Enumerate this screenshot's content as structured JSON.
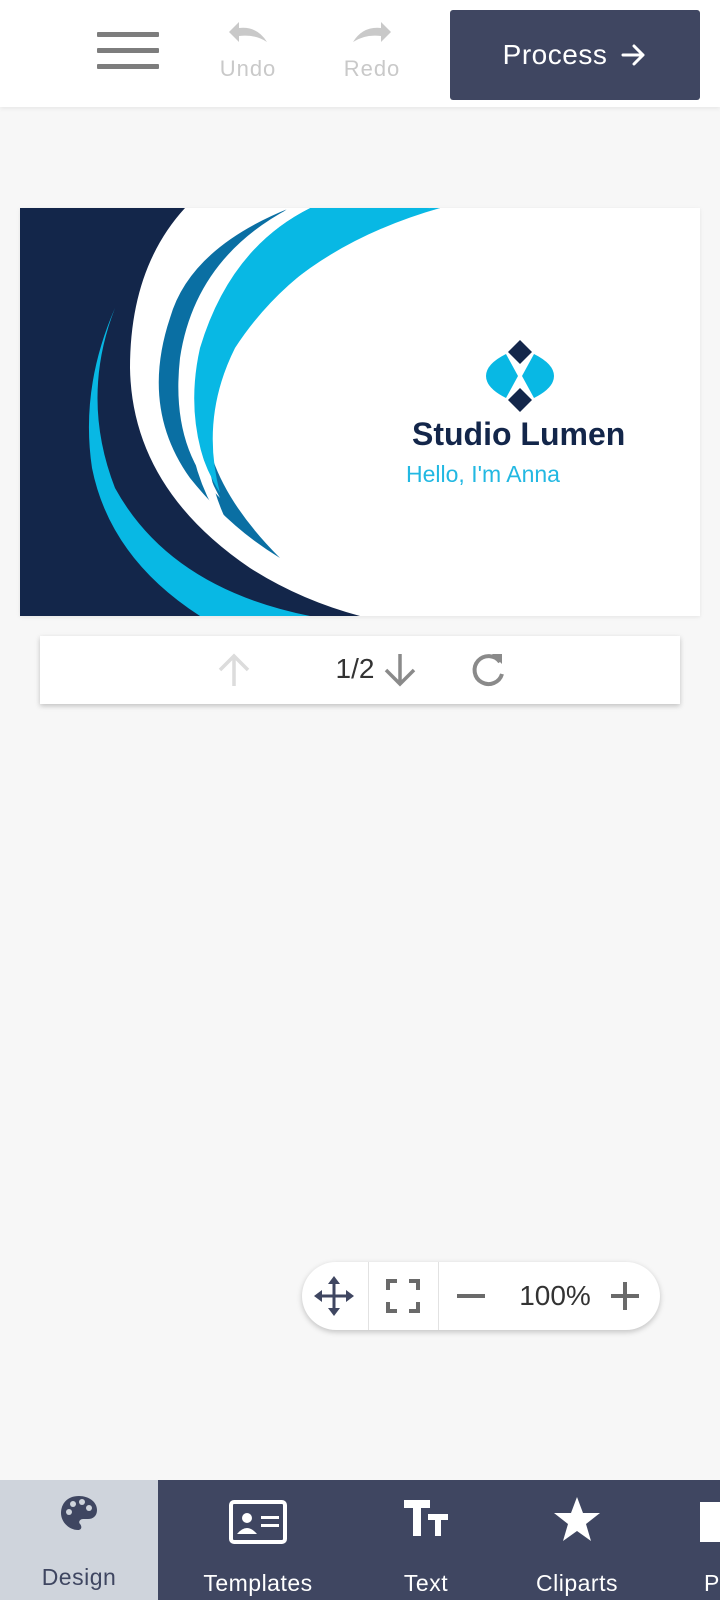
{
  "toolbar": {
    "undo_label": "Undo",
    "redo_label": "Redo",
    "process_label": "Process",
    "process_color": "#3f4661"
  },
  "card": {
    "company": "Studio Lumen",
    "greeting": "Hello, I'm Anna",
    "colors": {
      "navy": "#13264a",
      "blue": "#0a6fa3",
      "cyan": "#08b8e4"
    }
  },
  "pager": {
    "page": "1/2"
  },
  "zoom": {
    "value": "100%"
  },
  "tabs": [
    {
      "label": "Design",
      "icon": "palette-icon",
      "active": true
    },
    {
      "label": "Templates",
      "icon": "id-card-icon"
    },
    {
      "label": "Text",
      "icon": "text-size-icon"
    },
    {
      "label": "Cliparts",
      "icon": "star-icon"
    },
    {
      "label": "Pl",
      "icon": "photo-icon"
    }
  ]
}
